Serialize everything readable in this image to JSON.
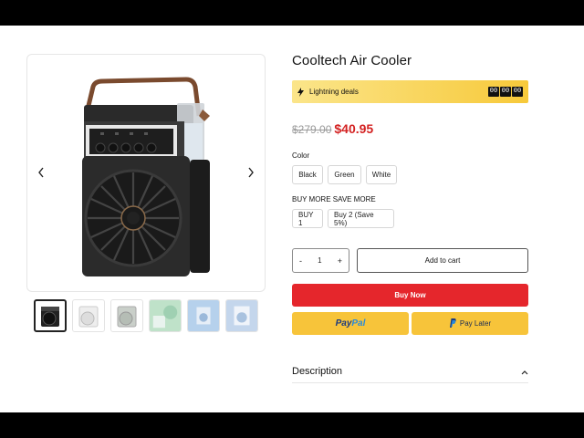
{
  "product": {
    "title": "Cooltech Air Cooler",
    "old_price": "$279.00",
    "new_price": "$40.95"
  },
  "deals": {
    "label": "Lightning deals",
    "timer": [
      "00",
      "00",
      "00"
    ]
  },
  "gallery": {
    "prev_icon": "chevron-left-icon",
    "next_icon": "chevron-right-icon",
    "thumbnails": [
      "black-cooler",
      "white-cooler",
      "gray-cooler",
      "green-scene",
      "blue-scene",
      "blue-scene-2"
    ]
  },
  "options": {
    "color_label": "Color",
    "colors": [
      "Black",
      "Green",
      "White"
    ],
    "bundle_label": "BUY MORE SAVE MORE",
    "bundles": [
      "BUY 1",
      "Buy 2 (Save 5%)"
    ]
  },
  "cart": {
    "minus": "-",
    "quantity": "1",
    "plus": "+",
    "add_to_cart": "Add to cart",
    "buy_now": "Buy Now",
    "paypal_a": "Pay",
    "paypal_b": "Pal",
    "pay_later": "Pay Later"
  },
  "description": {
    "label": "Description",
    "icon": "chevron-up-icon"
  },
  "colors": {
    "accent_red": "#e5262c",
    "price_red": "#d32222",
    "paypal_yellow": "#f7c43a",
    "deal_gradient_start": "#fbe58a",
    "deal_gradient_end": "#f7c93a"
  }
}
